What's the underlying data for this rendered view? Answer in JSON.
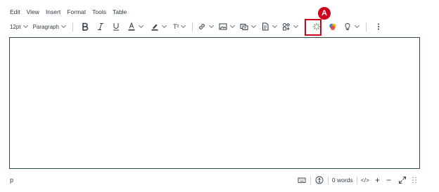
{
  "menubar": {
    "items": [
      "Edit",
      "View",
      "Insert",
      "Format",
      "Tools",
      "Table"
    ]
  },
  "toolbar": {
    "font_size": "12pt",
    "block_format": "Paragraph",
    "superscript_glyph": "T²",
    "icons": [
      "font-size-dropdown",
      "paragraph-dropdown",
      "bold-icon",
      "italic-icon",
      "underline-icon",
      "text-color-icon",
      "highlight-color-icon",
      "superscript-icon",
      "link-icon",
      "image-icon",
      "media-icon",
      "document-icon",
      "apps-icon",
      "ai-sparkle-icon",
      "colorful-app-icon",
      "lightbulb-icon",
      "more-options-icon"
    ]
  },
  "annotation": {
    "callout_label": "A",
    "color": "#d0021b"
  },
  "statusbar": {
    "path": "p",
    "word_count": "0 words",
    "html_toggle": "</>",
    "zoom_in": "+",
    "zoom_out": "−"
  },
  "colors": {
    "editor_border": "#2f4f3a",
    "text": "#2d3b45"
  }
}
